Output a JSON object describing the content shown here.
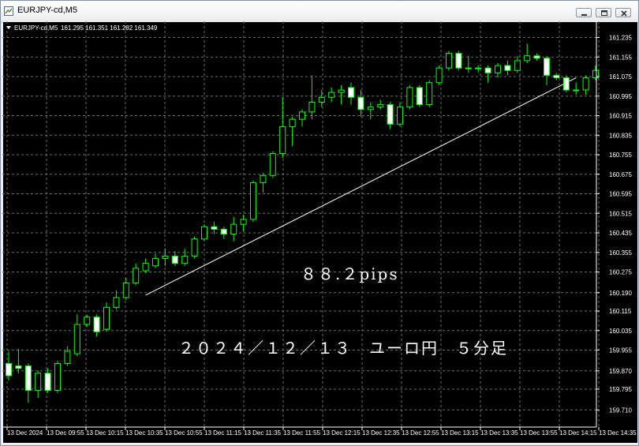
{
  "window": {
    "title": "EURJPY-cd,M5",
    "controls": [
      {
        "name": "minimize",
        "icon": "minimize-icon"
      },
      {
        "name": "restore",
        "icon": "restore-icon"
      },
      {
        "name": "close",
        "icon": "close-icon"
      }
    ]
  },
  "chart_header": {
    "symbol": "EURJPY-cd,M5",
    "ohlc": "161.295 161.351 161.282 161.349"
  },
  "annotations": {
    "pips": "８８.２pips",
    "title": "２０２４／１２／１３　ユーロ円　５分足"
  },
  "colors": {
    "background": "#000000",
    "grid": "#6e6e6e",
    "bull_candle": "#000000",
    "bear_candle": "#ffffff",
    "candle_outline": "#00ff00",
    "trendline": "#ffffff",
    "text": "#ffffff"
  },
  "chart_data": {
    "type": "candlestick",
    "symbol": "EURJPY-cd",
    "timeframe": "M5",
    "y_ticks": [
      159.71,
      159.795,
      159.87,
      159.955,
      160.035,
      160.115,
      160.19,
      160.275,
      160.355,
      160.435,
      160.515,
      160.595,
      160.675,
      160.755,
      160.835,
      160.915,
      160.995,
      161.075,
      161.155,
      161.235
    ],
    "x_ticks": [
      "13 Dec 2024",
      "13 Dec 09:55",
      "13 Dec 10:15",
      "13 Dec 10:35",
      "13 Dec 10:55",
      "13 Dec 11:15",
      "13 Dec 11:35",
      "13 Dec 11:55",
      "13 Dec 12:15",
      "13 Dec 12:35",
      "13 Dec 12:55",
      "13 Dec 13:15",
      "13 Dec 13:35",
      "13 Dec 13:55",
      "13 Dec 14:15",
      "13 Dec 14:35"
    ],
    "ylim": [
      159.7,
      161.28
    ],
    "grid": true,
    "candles": [
      {
        "o": 159.9,
        "h": 159.95,
        "l": 159.83,
        "c": 159.85
      },
      {
        "o": 159.89,
        "h": 159.96,
        "l": 159.86,
        "c": 159.88
      },
      {
        "o": 159.89,
        "h": 159.9,
        "l": 159.74,
        "c": 159.79
      },
      {
        "o": 159.79,
        "h": 159.87,
        "l": 159.76,
        "c": 159.86
      },
      {
        "o": 159.86,
        "h": 159.88,
        "l": 159.78,
        "c": 159.79
      },
      {
        "o": 159.79,
        "h": 159.91,
        "l": 159.78,
        "c": 159.9
      },
      {
        "o": 159.9,
        "h": 159.97,
        "l": 159.89,
        "c": 159.95
      },
      {
        "o": 159.94,
        "h": 160.1,
        "l": 159.93,
        "c": 160.06
      },
      {
        "o": 160.06,
        "h": 160.1,
        "l": 160.05,
        "c": 160.09
      },
      {
        "o": 160.09,
        "h": 160.1,
        "l": 160.01,
        "c": 160.03
      },
      {
        "o": 160.04,
        "h": 160.15,
        "l": 160.03,
        "c": 160.13
      },
      {
        "o": 160.13,
        "h": 160.2,
        "l": 160.12,
        "c": 160.17
      },
      {
        "o": 160.17,
        "h": 160.25,
        "l": 160.16,
        "c": 160.23
      },
      {
        "o": 160.23,
        "h": 160.31,
        "l": 160.22,
        "c": 160.29
      },
      {
        "o": 160.28,
        "h": 160.33,
        "l": 160.27,
        "c": 160.31
      },
      {
        "o": 160.3,
        "h": 160.35,
        "l": 160.29,
        "c": 160.33
      },
      {
        "o": 160.33,
        "h": 160.37,
        "l": 160.3,
        "c": 160.34
      },
      {
        "o": 160.34,
        "h": 160.36,
        "l": 160.3,
        "c": 160.31
      },
      {
        "o": 160.31,
        "h": 160.37,
        "l": 160.3,
        "c": 160.34
      },
      {
        "o": 160.34,
        "h": 160.42,
        "l": 160.33,
        "c": 160.41
      },
      {
        "o": 160.41,
        "h": 160.47,
        "l": 160.4,
        "c": 160.46
      },
      {
        "o": 160.46,
        "h": 160.48,
        "l": 160.43,
        "c": 160.45
      },
      {
        "o": 160.45,
        "h": 160.46,
        "l": 160.41,
        "c": 160.43
      },
      {
        "o": 160.43,
        "h": 160.5,
        "l": 160.4,
        "c": 160.47
      },
      {
        "o": 160.47,
        "h": 160.51,
        "l": 160.44,
        "c": 160.49
      },
      {
        "o": 160.49,
        "h": 160.65,
        "l": 160.48,
        "c": 160.64
      },
      {
        "o": 160.64,
        "h": 160.68,
        "l": 160.6,
        "c": 160.67
      },
      {
        "o": 160.67,
        "h": 160.77,
        "l": 160.66,
        "c": 160.76
      },
      {
        "o": 160.76,
        "h": 160.99,
        "l": 160.74,
        "c": 160.87
      },
      {
        "o": 160.87,
        "h": 160.91,
        "l": 160.79,
        "c": 160.9
      },
      {
        "o": 160.9,
        "h": 160.94,
        "l": 160.87,
        "c": 160.93
      },
      {
        "o": 160.93,
        "h": 161.08,
        "l": 160.9,
        "c": 160.97
      },
      {
        "o": 160.97,
        "h": 161.02,
        "l": 160.95,
        "c": 160.99
      },
      {
        "o": 160.99,
        "h": 161.03,
        "l": 160.97,
        "c": 161.01
      },
      {
        "o": 161.01,
        "h": 161.04,
        "l": 160.96,
        "c": 161.02
      },
      {
        "o": 161.03,
        "h": 161.05,
        "l": 160.96,
        "c": 160.99
      },
      {
        "o": 160.99,
        "h": 161.02,
        "l": 160.91,
        "c": 160.94
      },
      {
        "o": 160.94,
        "h": 160.97,
        "l": 160.9,
        "c": 160.95
      },
      {
        "o": 160.95,
        "h": 160.98,
        "l": 160.94,
        "c": 160.96
      },
      {
        "o": 160.96,
        "h": 160.97,
        "l": 160.86,
        "c": 160.88
      },
      {
        "o": 160.88,
        "h": 160.97,
        "l": 160.87,
        "c": 160.95
      },
      {
        "o": 160.95,
        "h": 161.04,
        "l": 160.94,
        "c": 161.03
      },
      {
        "o": 161.03,
        "h": 161.04,
        "l": 160.95,
        "c": 160.96
      },
      {
        "o": 160.96,
        "h": 161.06,
        "l": 160.95,
        "c": 161.05
      },
      {
        "o": 161.05,
        "h": 161.12,
        "l": 161.04,
        "c": 161.11
      },
      {
        "o": 161.11,
        "h": 161.18,
        "l": 161.1,
        "c": 161.17
      },
      {
        "o": 161.17,
        "h": 161.18,
        "l": 161.1,
        "c": 161.11
      },
      {
        "o": 161.11,
        "h": 161.16,
        "l": 161.09,
        "c": 161.11
      },
      {
        "o": 161.11,
        "h": 161.12,
        "l": 161.09,
        "c": 161.11
      },
      {
        "o": 161.11,
        "h": 161.12,
        "l": 161.05,
        "c": 161.09
      },
      {
        "o": 161.09,
        "h": 161.13,
        "l": 161.07,
        "c": 161.12
      },
      {
        "o": 161.12,
        "h": 161.14,
        "l": 161.08,
        "c": 161.1
      },
      {
        "o": 161.1,
        "h": 161.16,
        "l": 161.09,
        "c": 161.14
      },
      {
        "o": 161.14,
        "h": 161.21,
        "l": 161.13,
        "c": 161.16
      },
      {
        "o": 161.16,
        "h": 161.17,
        "l": 161.14,
        "c": 161.15
      },
      {
        "o": 161.15,
        "h": 161.16,
        "l": 161.04,
        "c": 161.08
      },
      {
        "o": 161.08,
        "h": 161.09,
        "l": 161.06,
        "c": 161.07
      },
      {
        "o": 161.07,
        "h": 161.08,
        "l": 161.01,
        "c": 161.02
      },
      {
        "o": 161.02,
        "h": 161.05,
        "l": 161.0,
        "c": 161.02
      },
      {
        "o": 161.02,
        "h": 161.08,
        "l": 161.0,
        "c": 161.07
      },
      {
        "o": 161.07,
        "h": 161.12,
        "l": 161.06,
        "c": 161.1
      }
    ],
    "trendline": {
      "from": {
        "candle": 14,
        "price": 160.18
      },
      "to": {
        "candle": 58,
        "price": 161.07
      }
    }
  }
}
